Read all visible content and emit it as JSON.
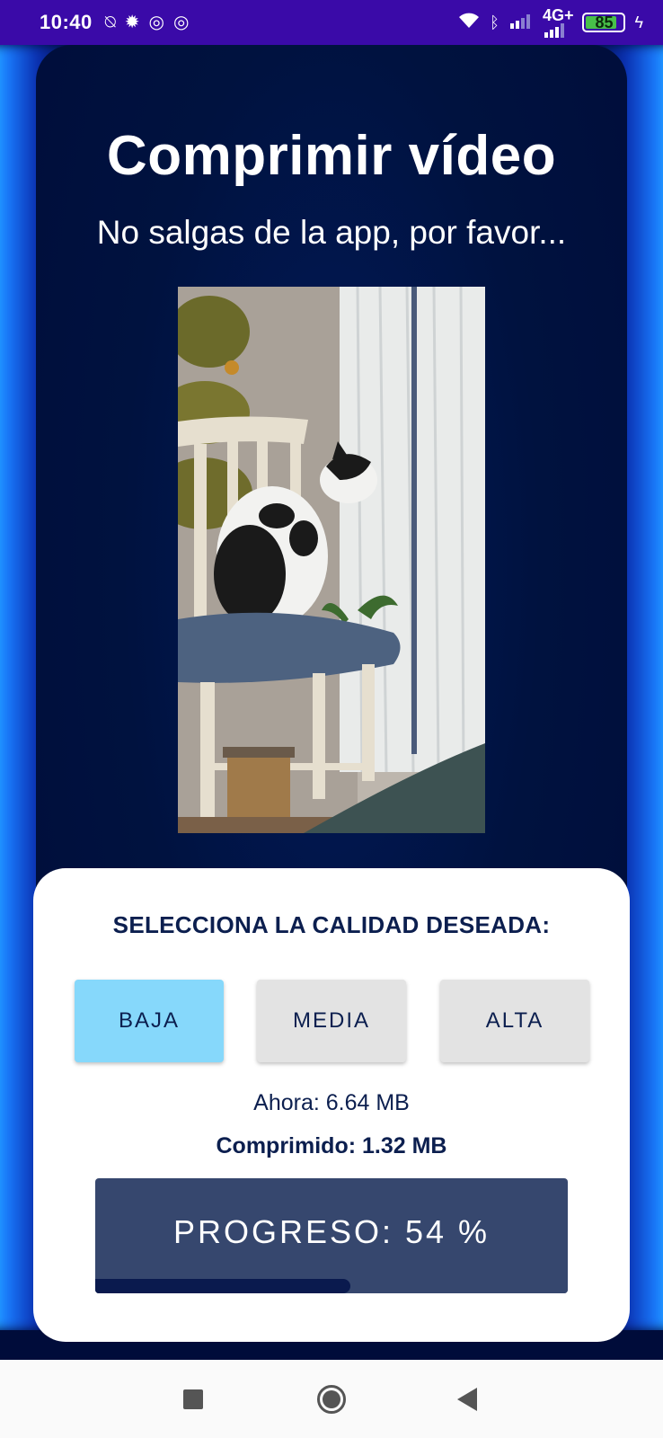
{
  "status_bar": {
    "time": "10:40",
    "left_icons": [
      "alarm-off-icon",
      "settings-icon",
      "at-icon",
      "at-icon"
    ],
    "network": "4G+",
    "battery": "85"
  },
  "screen": {
    "title": "Comprimir vídeo",
    "subtitle": "No salgas de la app, por favor..."
  },
  "quality": {
    "heading": "SELECCIONA LA CALIDAD DESEADA:",
    "options": [
      {
        "label": "BAJA",
        "selected": true
      },
      {
        "label": "MEDIA",
        "selected": false
      },
      {
        "label": "ALTA",
        "selected": false
      }
    ]
  },
  "sizes": {
    "now": "Ahora: 6.64 MB",
    "compressed": "Comprimido: 1.32 MB"
  },
  "progress": {
    "label": "PROGRESO: 54 %",
    "value": 0.54
  },
  "colors": {
    "status_bar": "#3a0aa8",
    "background": "#000c3a",
    "selected_button": "#86d8fb",
    "button": "#e3e3e3",
    "progress_box": "#36476e",
    "progress_fill": "#0a1a4e",
    "text_dark": "#0c1f4f"
  }
}
